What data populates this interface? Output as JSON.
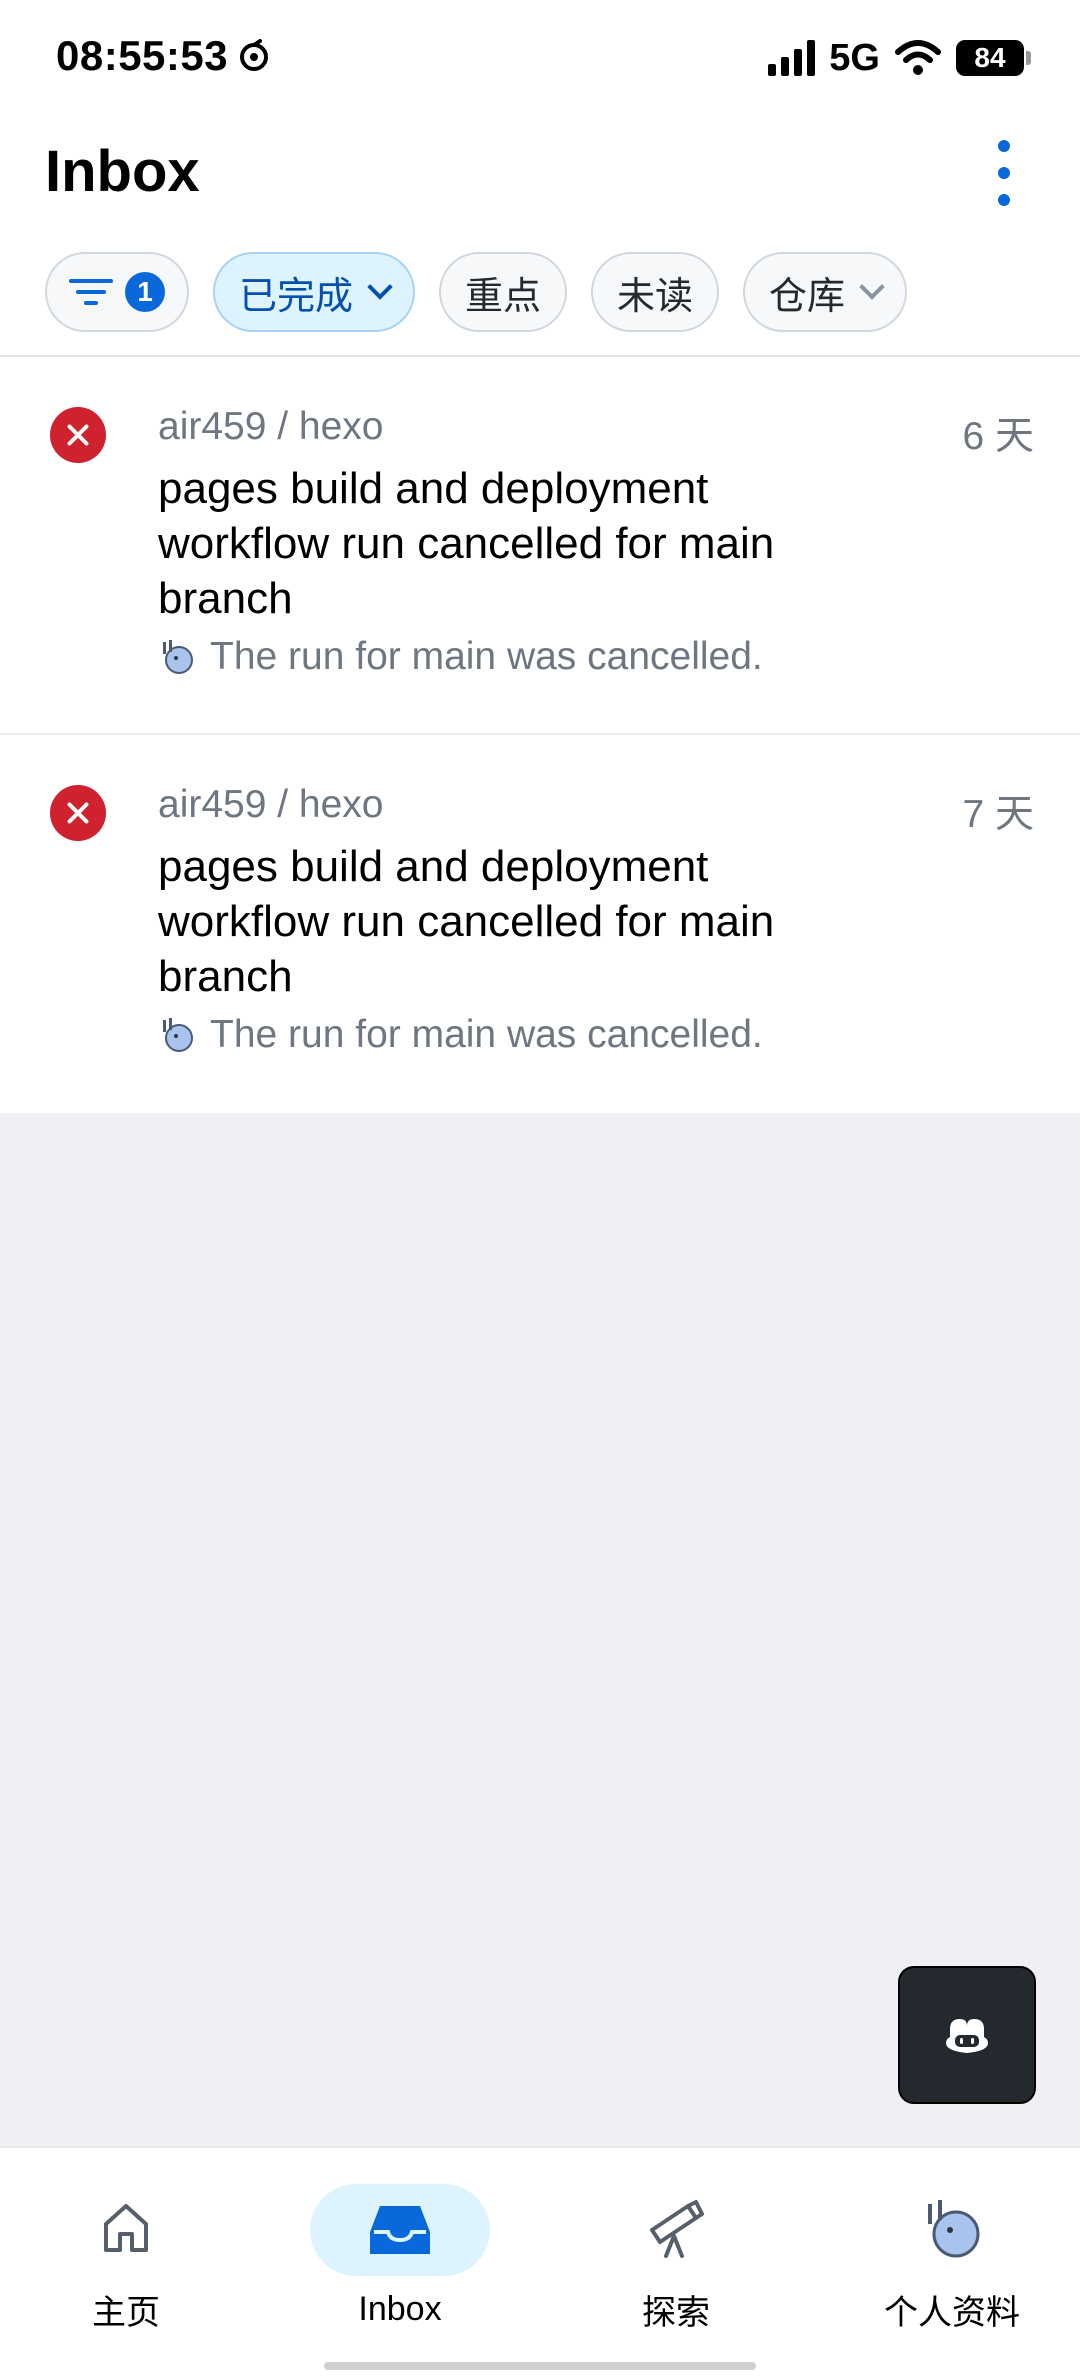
{
  "status_bar": {
    "time": "08:55:53",
    "network": "5G",
    "battery": "84"
  },
  "header": {
    "title": "Inbox",
    "more_icon": "kebab-vertical-icon"
  },
  "filters": {
    "filter_count": "1",
    "chips": [
      "已完成",
      "重点",
      "未读",
      "仓库"
    ]
  },
  "notifications": [
    {
      "repo": "air459 / hexo",
      "time": "6 天",
      "title": "pages build and deployment workflow run cancelled for main branch",
      "subtitle": "The run for main was cancelled.",
      "status_icon": "x-circle-icon"
    },
    {
      "repo": "air459 / hexo",
      "time": "7 天",
      "title": "pages build and deployment workflow run cancelled for main branch",
      "subtitle": "The run for main was cancelled.",
      "status_icon": "x-circle-icon"
    }
  ],
  "tabbar": {
    "home": "主页",
    "inbox": "Inbox",
    "explore": "探索",
    "profile": "个人资料"
  },
  "colors": {
    "accent": "#0969da",
    "danger": "#cf222e"
  }
}
